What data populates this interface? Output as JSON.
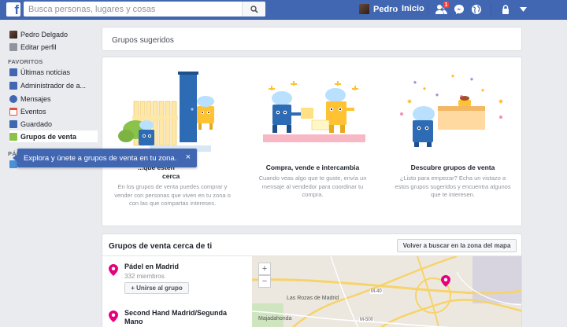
{
  "topbar": {
    "logo_letter": "f",
    "search_placeholder": "Busca personas, lugares y cosas",
    "user_name": "Pedro",
    "home_label": "Inicio",
    "friend_requests_count": "1"
  },
  "sidebar": {
    "profile_name": "Pedro Delgado",
    "edit_profile": "Editar perfil",
    "favorites_heading": "FAVORITOS",
    "items": [
      {
        "label": "Últimas noticias",
        "icon": "news-feed-icon",
        "color": "#4267b2"
      },
      {
        "label": "Administrador de a...",
        "icon": "ads-manager-icon",
        "color": "#4267b2"
      },
      {
        "label": "Mensajes",
        "icon": "messages-icon",
        "color": "#4267b2"
      },
      {
        "label": "Eventos",
        "icon": "events-icon",
        "color": "#e84e40"
      },
      {
        "label": "Guardado",
        "icon": "saved-icon",
        "color": "#4267b2"
      },
      {
        "label": "Grupos de venta",
        "icon": "sale-groups-icon",
        "color": "#8bc34a"
      }
    ],
    "pages_heading": "PÁG"
  },
  "tooltip": {
    "text": "Explora y únete a grupos de venta en tu zona.",
    "close": "×"
  },
  "suggested": {
    "title": "Grupos sugeridos"
  },
  "promo": {
    "columns": [
      {
        "title_line1": "...que estén",
        "title_line2": "cerca",
        "desc": "En los grupos de venta puedes comprar y vender con personas que viven en tu zona o con las que compartas intereses."
      },
      {
        "title_line1": "Compra, vende e intercambia",
        "desc": "Cuando veas algo que te guste, envía un mensaje al vendedor para coordinar tu compra."
      },
      {
        "title_line1": "Descubre grupos de venta",
        "desc": "¿Listo para empezar? Echa un vistazo a estos grupos sugeridos y encuentra algunos que te interesen."
      }
    ]
  },
  "nearby": {
    "title": "Grupos de venta cerca de ti",
    "map_button": "Volver a buscar en la zona del mapa",
    "groups": [
      {
        "name": "Pádel en Madrid",
        "members": "332 miembros",
        "join": "+ Unirse al grupo"
      },
      {
        "name_line1": "Second Hand Madrid/Segunda",
        "name_line2": "Mano"
      }
    ],
    "map": {
      "zoom_in": "+",
      "zoom_out": "−",
      "labels": [
        "Las Rozas de Madrid",
        "Majadahonda",
        "M-40",
        "M-500"
      ]
    }
  },
  "colors": {
    "brand": "#4267b2",
    "pin": "#e6007e",
    "background": "#e9ebee"
  }
}
